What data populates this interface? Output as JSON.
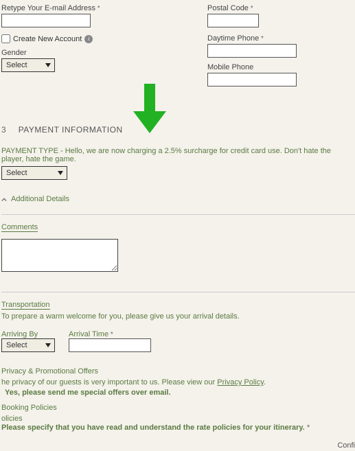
{
  "left": {
    "retype_email_label": "Retype Your E-mail Address",
    "create_account_label": "Create New Account",
    "gender_label": "Gender",
    "gender_select": "Select"
  },
  "right": {
    "postal_label": "Postal Code",
    "daytime_label": "Daytime Phone",
    "mobile_label": "Mobile Phone"
  },
  "payment": {
    "num": "3",
    "title": "PAYMENT INFORMATION",
    "type_note": "PAYMENT TYPE - Hello, we are now charging a 2.5% surcharge for credit card use. Don't hate the player, hate the game.",
    "select": "Select"
  },
  "additional": {
    "title": "Additional Details",
    "comments_label": "Comments"
  },
  "transport": {
    "title": "Transportation",
    "note": "To prepare a warm welcome for you, please give us your arrival details.",
    "arriving_label": "Arriving By",
    "arriving_select": "Select",
    "arrival_time_label": "Arrival Time"
  },
  "privacy": {
    "title": "Privacy & Promotional Offers",
    "line1_a": "he privacy of our guests is very important to us. Please view our ",
    "line1_link": "Privacy Policy",
    "line1_b": ".",
    "checkbox_label": "Yes, please send me special offers over email."
  },
  "booking": {
    "title": "Booking Policies",
    "sub": "olicies",
    "line": "Please specify that you have read and understand the rate policies for your itinerary."
  },
  "footer": {
    "confi": "Confi"
  }
}
